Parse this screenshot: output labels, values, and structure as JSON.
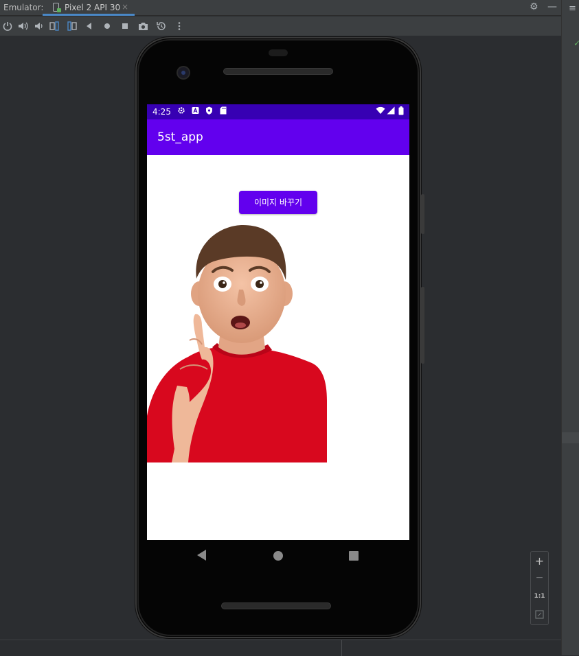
{
  "ide": {
    "panel_label": "Emulator:",
    "device_tab": "Pixel 2 API 30",
    "tab_close": "×",
    "toolbar_icons": [
      "power-icon",
      "volume-up-icon",
      "volume-down-icon",
      "rotate-left-icon",
      "rotate-right-icon",
      "back-icon",
      "home-icon",
      "overview-icon",
      "screenshot-icon",
      "snapshot-icon",
      "more-icon"
    ],
    "zoom": {
      "plus": "+",
      "minus": "−",
      "one_to_one": "1:1"
    }
  },
  "device": {
    "status_bar": {
      "time": "4:25",
      "color": "#3700b3"
    },
    "app_bar": {
      "title": "5st_app",
      "color": "#6200ee"
    },
    "change_image_button": "이미지 바꾸기",
    "accent": "#6200ee"
  }
}
